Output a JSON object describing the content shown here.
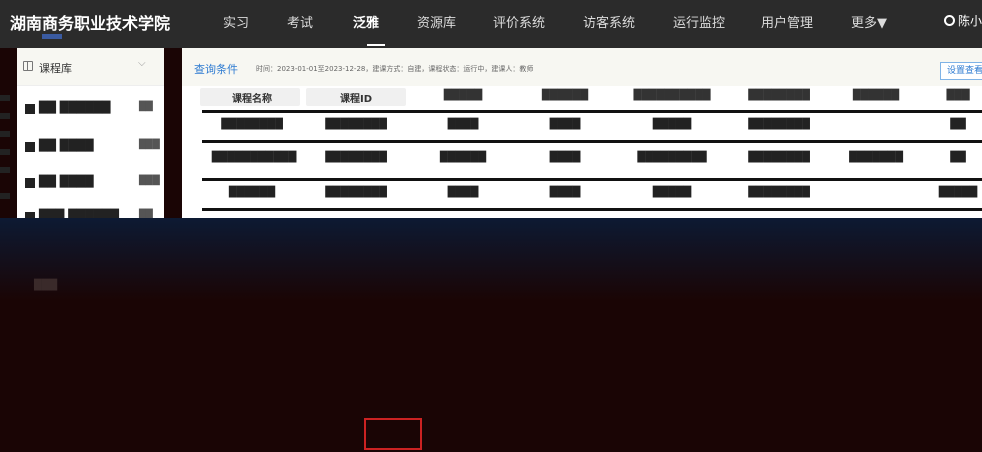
{
  "header": {
    "logo_text": "湖南商务职业技术学院",
    "nav": [
      {
        "label": "实习",
        "active": false
      },
      {
        "label": "考试",
        "active": false
      },
      {
        "label": "泛雅",
        "active": true
      },
      {
        "label": "资源库",
        "active": false
      },
      {
        "label": "评价系统",
        "active": false
      },
      {
        "label": "访客系统",
        "active": false
      },
      {
        "label": "运行监控",
        "active": false
      },
      {
        "label": "用户管理",
        "active": false
      },
      {
        "label": "更多▼",
        "active": false
      }
    ],
    "user_name": "陈小"
  },
  "sidebar": {
    "title": "课程库",
    "items": [
      {
        "label": "██ ██████",
        "count": "██"
      },
      {
        "label": "██ ████",
        "count": "███"
      },
      {
        "label": "██ ████",
        "count": "███"
      },
      {
        "label": "███ ██████",
        "count": "██"
      }
    ]
  },
  "query": {
    "label": "查询条件",
    "conditions": "时间：2023-01-01至2023-12-28，建课方式：自建，课程状态：运行中，建课人：教师",
    "settings_button": "设置查看"
  },
  "table": {
    "headers": [
      "课程名称",
      "课程ID",
      "█████",
      "██████",
      "██████████",
      "████████",
      "██████",
      "███"
    ],
    "rows": [
      [
        "████████",
        "████████",
        "████",
        "████",
        "█████",
        "████████",
        "",
        "██"
      ],
      [
        "███████████",
        "████████",
        "██████",
        "████",
        "█████████",
        "████████",
        "███████",
        "██"
      ],
      [
        "██████",
        "████████",
        "████",
        "████",
        "█████",
        "████████",
        "",
        "█████"
      ]
    ]
  },
  "footer": {
    "side_label": "███"
  }
}
